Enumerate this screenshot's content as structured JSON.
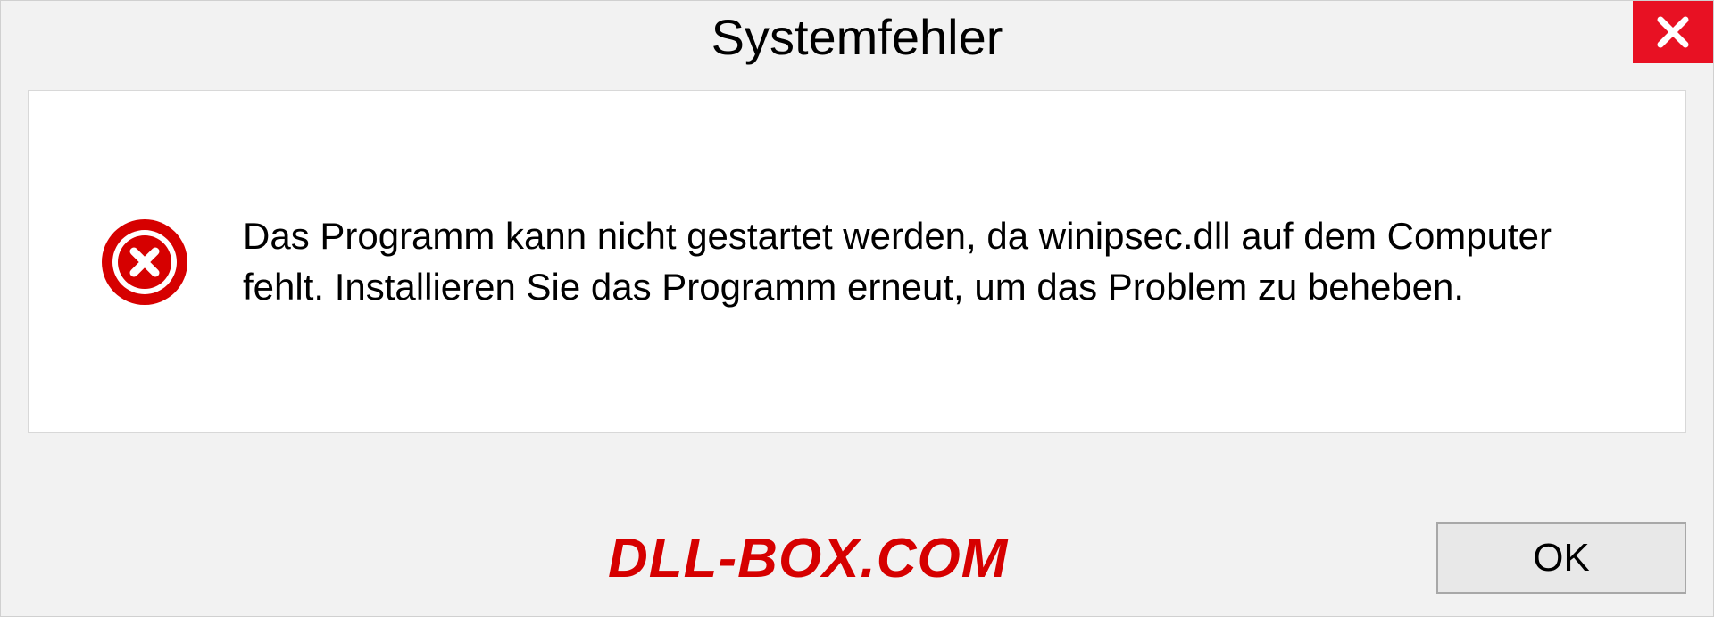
{
  "dialog": {
    "title": "Systemfehler",
    "message": "Das Programm kann nicht gestartet werden, da winipsec.dll auf dem Computer fehlt. Installieren Sie das Programm erneut, um das Problem zu beheben.",
    "ok_label": "OK"
  },
  "watermark": "DLL-BOX.COM"
}
